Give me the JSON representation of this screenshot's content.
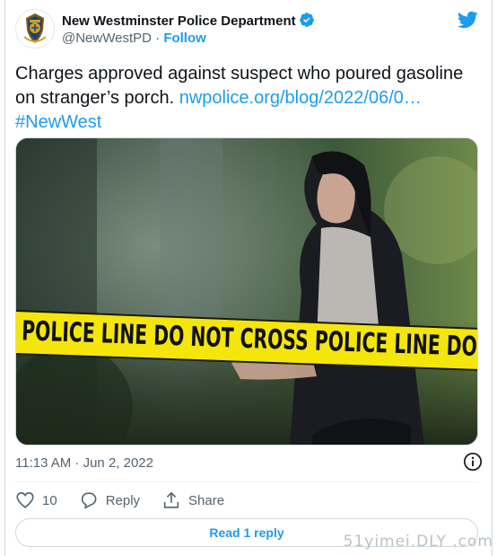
{
  "account": {
    "name": "New Westminster Police Department",
    "handle": "@NewWestPD",
    "separator": "·",
    "follow_label": "Follow"
  },
  "tweet": {
    "text": "Charges approved against suspect who poured gasoline on stranger’s porch.",
    "link": "nwpolice.org/blog/2022/06/0…",
    "hashtag": "#NewWest",
    "timestamp": "11:13 AM · Jun 2, 2022"
  },
  "media": {
    "tape_text": "POLICE LINE DO NOT CROSS    POLICE LINE DO"
  },
  "actions": {
    "like_count": "10",
    "reply_label": "Reply",
    "share_label": "Share"
  },
  "read_reply_label": "Read 1 reply",
  "watermark": "51yimei.DLY .com",
  "colors": {
    "accent": "#1d9bf0",
    "text": "#0f1419",
    "secondary": "#536471",
    "tape": "#f4e60a"
  },
  "icons": [
    "police-crest-icon",
    "verified-badge-icon",
    "twitter-bird-icon",
    "info-icon",
    "heart-icon",
    "reply-bubble-icon",
    "share-icon"
  ]
}
